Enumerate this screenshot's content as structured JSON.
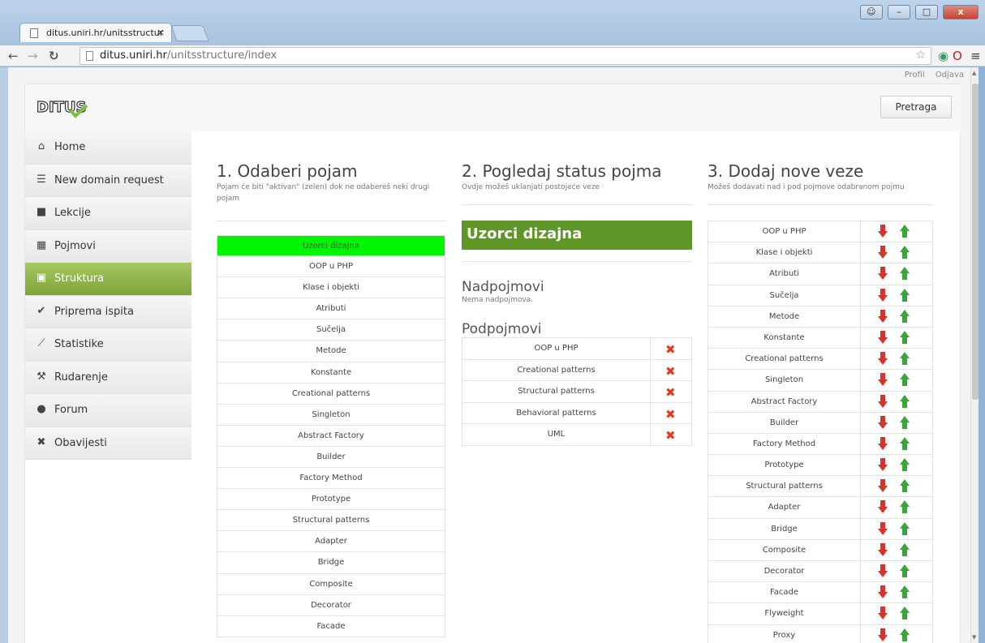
{
  "browser": {
    "tab_title": "ditus.uniri.hr/unitsstructur",
    "tab_close": "×",
    "url_host": "ditus.uniri.hr",
    "url_path": "/unitsstructure/index"
  },
  "toplinks": {
    "profile": "Profil",
    "logout": "Odjava"
  },
  "header": {
    "search_button": "Pretraga"
  },
  "sidebar": {
    "items": [
      {
        "label": "Home",
        "icon": "home-icon"
      },
      {
        "label": "New domain request",
        "icon": "list-icon"
      },
      {
        "label": "Lekcije",
        "icon": "book-icon"
      },
      {
        "label": "Pojmovi",
        "icon": "grid-icon"
      },
      {
        "label": "Struktura",
        "icon": "structure-icon"
      },
      {
        "label": "Priprema ispita",
        "icon": "check-icon"
      },
      {
        "label": "Statistike",
        "icon": "chart-icon"
      },
      {
        "label": "Rudarenje",
        "icon": "mining-icon"
      },
      {
        "label": "Forum",
        "icon": "chat-icon"
      },
      {
        "label": "Obavijesti",
        "icon": "notice-icon"
      }
    ],
    "active_index": 4
  },
  "col1": {
    "title": "1. Odaberi pojam",
    "subtitle": "Pojam će biti \"aktivan\" (zelen) dok ne odabereš neki drugi pojam",
    "items": [
      "Uzorci dizajna",
      "OOP u PHP",
      "Klase i objekti",
      "Atributi",
      "Sučelja",
      "Metode",
      "Konstante",
      "Creational patterns",
      "Singleton",
      "Abstract Factory",
      "Builder",
      "Factory Method",
      "Prototype",
      "Structural patterns",
      "Adapter",
      "Bridge",
      "Composite",
      "Decorator",
      "Facade"
    ],
    "selected_index": 0
  },
  "col2": {
    "title": "2. Pogledaj status pojma",
    "subtitle": "Ovdje možeš uklanjati postojeće veze",
    "current": "Uzorci dizajna",
    "parents_title": "Nadpojmovi",
    "parents_note": "Nema nadpojmova.",
    "children_title": "Podpojmovi",
    "children": [
      "OOP u PHP",
      "Creational patterns",
      "Structural patterns",
      "Behavioral patterns",
      "UML"
    ]
  },
  "col3": {
    "title": "3. Dodaj nove veze",
    "subtitle": "Možeš dodavati nad i pod pojmove odabranom pojmu",
    "items": [
      "OOP u PHP",
      "Klase i objekti",
      "Atributi",
      "Sučelja",
      "Metode",
      "Konstante",
      "Creational patterns",
      "Singleton",
      "Abstract Factory",
      "Builder",
      "Factory Method",
      "Prototype",
      "Structural patterns",
      "Adapter",
      "Bridge",
      "Composite",
      "Decorator",
      "Facade",
      "Flyweight",
      "Proxy"
    ]
  },
  "colors": {
    "selected": "#00f500",
    "banner": "#5f9628",
    "active_nav": "#8db347",
    "remove": "#e23c1d",
    "down": "#d8322a",
    "up": "#3aa53a"
  }
}
